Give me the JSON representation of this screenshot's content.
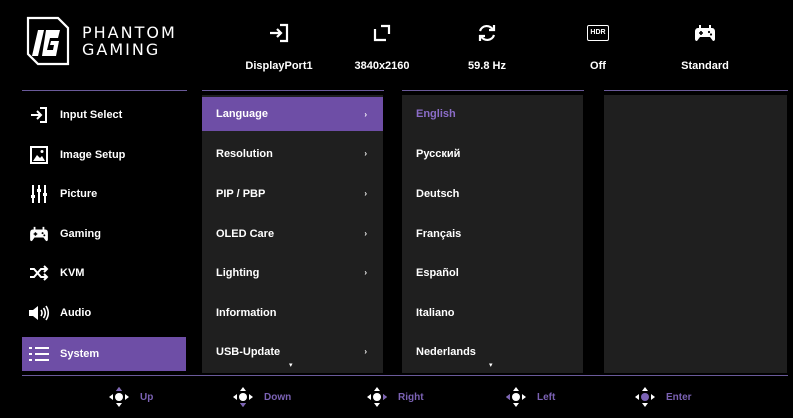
{
  "brand": {
    "line1": "PHANTOM",
    "line2": "GAMING"
  },
  "status": [
    {
      "icon": "input-icon",
      "value": "DisplayPort1"
    },
    {
      "icon": "resolution-icon",
      "value": "3840x2160"
    },
    {
      "icon": "refresh-rate-icon",
      "value": "59.8 Hz"
    },
    {
      "icon": "hdr-icon",
      "icon_text": "HDR",
      "value": "Off"
    },
    {
      "icon": "gamepad-icon",
      "value": "Standard"
    }
  ],
  "main_menu": [
    {
      "icon": "input-select-icon",
      "label": "Input Select"
    },
    {
      "icon": "image-setup-icon",
      "label": "Image Setup"
    },
    {
      "icon": "picture-sliders-icon",
      "label": "Picture"
    },
    {
      "icon": "gamepad-icon",
      "label": "Gaming"
    },
    {
      "icon": "kvm-shuffle-icon",
      "label": "KVM"
    },
    {
      "icon": "speaker-icon",
      "label": "Audio"
    },
    {
      "icon": "list-icon",
      "label": "System",
      "active": true
    }
  ],
  "system_menu": [
    {
      "label": "Language",
      "arrow": "›",
      "active": true
    },
    {
      "label": "Resolution",
      "arrow": "›"
    },
    {
      "label": "PIP / PBP",
      "arrow": "›"
    },
    {
      "label": "OLED Care",
      "arrow": "›"
    },
    {
      "label": "Lighting",
      "arrow": "›"
    },
    {
      "label": "Information"
    },
    {
      "label": "USB-Update",
      "arrow": "›"
    }
  ],
  "languages": [
    {
      "label": "English",
      "selected": true
    },
    {
      "label": "Русский"
    },
    {
      "label": "Deutsch"
    },
    {
      "label": "Français"
    },
    {
      "label": "Español"
    },
    {
      "label": "Italiano"
    },
    {
      "label": "Nederlands"
    }
  ],
  "more_indicator": "▾",
  "footer": [
    {
      "label": "Up"
    },
    {
      "label": "Down"
    },
    {
      "label": "Right"
    },
    {
      "label": "Left"
    },
    {
      "label": "Enter"
    }
  ],
  "colors": {
    "accent": "#6e4ea6",
    "accent_text": "#8b6cc8",
    "panel": "#1f1f1f",
    "line": "#6a5a9a"
  }
}
